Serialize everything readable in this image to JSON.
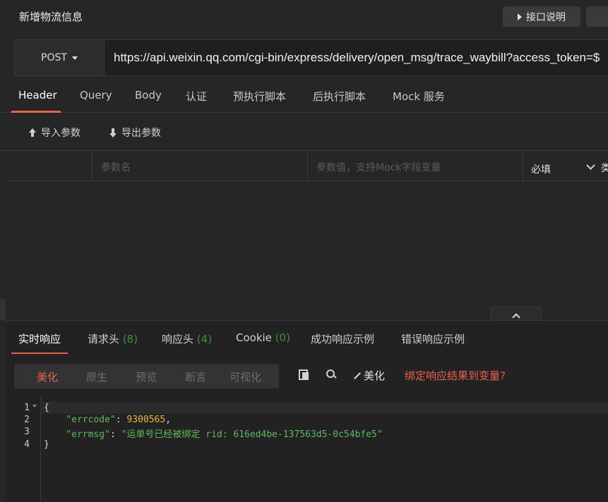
{
  "header": {
    "title": "新增物流信息",
    "doc_button": "接口说明"
  },
  "request": {
    "method": "POST",
    "url": "https://api.weixin.qq.com/cgi-bin/express/delivery/open_msg/trace_waybill?access_token=$"
  },
  "tabs": [
    "Header",
    "Query",
    "Body",
    "认证",
    "预执行脚本",
    "后执行脚本",
    "Mock 服务"
  ],
  "params": {
    "import_label": "导入参数",
    "export_label": "导出参数",
    "name_placeholder": "参数名",
    "value_placeholder": "参数值，支持Mock字段变量",
    "required_label": "必填",
    "type_label": "类"
  },
  "response": {
    "tabs": [
      {
        "label": "实时响应",
        "count": ""
      },
      {
        "label": "请求头",
        "count": "(8)"
      },
      {
        "label": "响应头",
        "count": "(4)"
      },
      {
        "label": "Cookie",
        "count": "(0)"
      },
      {
        "label": "成功响应示例",
        "count": ""
      },
      {
        "label": "错误响应示例",
        "count": ""
      }
    ],
    "view_modes": [
      "美化",
      "原生",
      "预览",
      "断言",
      "可视化"
    ],
    "beautify_label": "美化",
    "bind_link": "绑定响应结果到变量?",
    "body": {
      "errcode_key": "\"errcode\"",
      "errcode_value": "9300565",
      "errmsg_key": "\"errmsg\"",
      "errmsg_value": "\"运单号已经被绑定 rid: 616ed4be-137563d5-0c54bfe5\""
    }
  },
  "colors": {
    "accent": "#e8614e",
    "json_string": "#5fb75f",
    "json_number": "#e8b73a"
  }
}
